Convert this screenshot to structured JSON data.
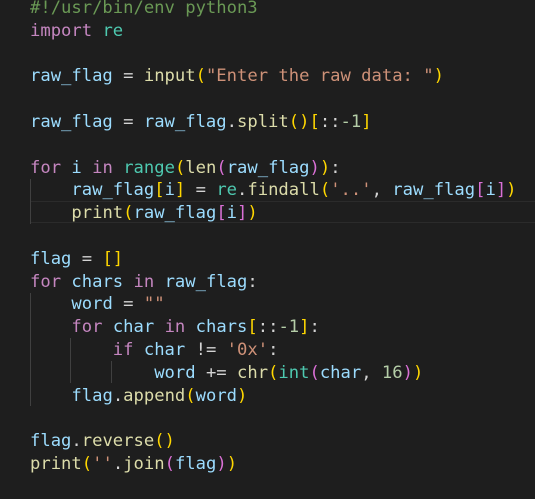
{
  "editor": {
    "language": "python",
    "colors": {
      "background": "#1e1e1e",
      "comment": "#6a9955",
      "keyword": "#c586c0",
      "variable": "#9cdcfe",
      "function": "#dcdcaa",
      "string": "#ce9178",
      "number": "#b5cea8",
      "operator": "#d4d4d4",
      "module": "#4ec9b0",
      "bracket_level_1": "#ffd700",
      "bracket_level_2": "#da70d6",
      "bracket_level_3": "#179fff"
    },
    "lines": [
      {
        "indent": "",
        "tokens": [
          {
            "t": "#!/usr/bin/env python3",
            "c": "comment"
          }
        ]
      },
      {
        "indent": "",
        "tokens": [
          {
            "t": "import",
            "c": "keyword"
          },
          {
            "t": " ",
            "c": "op"
          },
          {
            "t": "re",
            "c": "module"
          }
        ]
      },
      {
        "indent": "",
        "tokens": []
      },
      {
        "indent": "",
        "tokens": [
          {
            "t": "raw_flag",
            "c": "var"
          },
          {
            "t": " = ",
            "c": "op"
          },
          {
            "t": "input",
            "c": "func"
          },
          {
            "t": "(",
            "c": "b1"
          },
          {
            "t": "\"Enter the raw data: \"",
            "c": "str"
          },
          {
            "t": ")",
            "c": "b1"
          }
        ]
      },
      {
        "indent": "",
        "tokens": []
      },
      {
        "indent": "",
        "tokens": [
          {
            "t": "raw_flag",
            "c": "var"
          },
          {
            "t": " = ",
            "c": "op"
          },
          {
            "t": "raw_flag",
            "c": "var"
          },
          {
            "t": ".",
            "c": "op"
          },
          {
            "t": "split",
            "c": "func"
          },
          {
            "t": "()",
            "c": "b1"
          },
          {
            "t": "[",
            "c": "b1"
          },
          {
            "t": "::",
            "c": "op"
          },
          {
            "t": "-1",
            "c": "num"
          },
          {
            "t": "]",
            "c": "b1"
          }
        ]
      },
      {
        "indent": "",
        "tokens": []
      },
      {
        "indent": "",
        "tokens": [
          {
            "t": "for",
            "c": "keyword"
          },
          {
            "t": " ",
            "c": "op"
          },
          {
            "t": "i",
            "c": "var"
          },
          {
            "t": " ",
            "c": "op"
          },
          {
            "t": "in",
            "c": "keyword"
          },
          {
            "t": " ",
            "c": "op"
          },
          {
            "t": "range",
            "c": "module"
          },
          {
            "t": "(",
            "c": "b1"
          },
          {
            "t": "len",
            "c": "func"
          },
          {
            "t": "(",
            "c": "b2"
          },
          {
            "t": "raw_flag",
            "c": "var"
          },
          {
            "t": ")",
            "c": "b2"
          },
          {
            "t": ")",
            "c": "b1"
          },
          {
            "t": ":",
            "c": "op"
          }
        ]
      },
      {
        "indent": "    ",
        "tokens": [
          {
            "t": "raw_flag",
            "c": "var"
          },
          {
            "t": "[",
            "c": "b1"
          },
          {
            "t": "i",
            "c": "var"
          },
          {
            "t": "]",
            "c": "b1"
          },
          {
            "t": " = ",
            "c": "op"
          },
          {
            "t": "re",
            "c": "module"
          },
          {
            "t": ".",
            "c": "op"
          },
          {
            "t": "findall",
            "c": "func"
          },
          {
            "t": "(",
            "c": "b1"
          },
          {
            "t": "'..'",
            "c": "str"
          },
          {
            "t": ", ",
            "c": "op"
          },
          {
            "t": "raw_flag",
            "c": "var"
          },
          {
            "t": "[",
            "c": "b2"
          },
          {
            "t": "i",
            "c": "var"
          },
          {
            "t": "]",
            "c": "b2"
          },
          {
            "t": ")",
            "c": "b1"
          }
        ]
      },
      {
        "indent": "    ",
        "tokens": [
          {
            "t": "print",
            "c": "func"
          },
          {
            "t": "(",
            "c": "b1"
          },
          {
            "t": "raw_flag",
            "c": "var"
          },
          {
            "t": "[",
            "c": "b2"
          },
          {
            "t": "i",
            "c": "var"
          },
          {
            "t": "]",
            "c": "b2"
          },
          {
            "t": ")",
            "c": "b1"
          }
        ]
      },
      {
        "indent": "",
        "tokens": []
      },
      {
        "indent": "",
        "tokens": [
          {
            "t": "flag",
            "c": "var"
          },
          {
            "t": " = ",
            "c": "op"
          },
          {
            "t": "[]",
            "c": "b1"
          }
        ]
      },
      {
        "indent": "",
        "tokens": [
          {
            "t": "for",
            "c": "keyword"
          },
          {
            "t": " ",
            "c": "op"
          },
          {
            "t": "chars",
            "c": "var"
          },
          {
            "t": " ",
            "c": "op"
          },
          {
            "t": "in",
            "c": "keyword"
          },
          {
            "t": " ",
            "c": "op"
          },
          {
            "t": "raw_flag",
            "c": "var"
          },
          {
            "t": ":",
            "c": "op"
          }
        ]
      },
      {
        "indent": "    ",
        "tokens": [
          {
            "t": "word",
            "c": "var"
          },
          {
            "t": " = ",
            "c": "op"
          },
          {
            "t": "\"\"",
            "c": "str"
          }
        ]
      },
      {
        "indent": "    ",
        "tokens": [
          {
            "t": "for",
            "c": "keyword"
          },
          {
            "t": " ",
            "c": "op"
          },
          {
            "t": "char",
            "c": "var"
          },
          {
            "t": " ",
            "c": "op"
          },
          {
            "t": "in",
            "c": "keyword"
          },
          {
            "t": " ",
            "c": "op"
          },
          {
            "t": "chars",
            "c": "var"
          },
          {
            "t": "[",
            "c": "b1"
          },
          {
            "t": "::",
            "c": "op"
          },
          {
            "t": "-1",
            "c": "num"
          },
          {
            "t": "]",
            "c": "b1"
          },
          {
            "t": ":",
            "c": "op"
          }
        ]
      },
      {
        "indent": "        ",
        "tokens": [
          {
            "t": "if",
            "c": "keyword"
          },
          {
            "t": " ",
            "c": "op"
          },
          {
            "t": "char",
            "c": "var"
          },
          {
            "t": " != ",
            "c": "op"
          },
          {
            "t": "'0x'",
            "c": "str"
          },
          {
            "t": ":",
            "c": "op"
          }
        ]
      },
      {
        "indent": "            ",
        "tokens": [
          {
            "t": "word",
            "c": "var"
          },
          {
            "t": " += ",
            "c": "op"
          },
          {
            "t": "chr",
            "c": "func"
          },
          {
            "t": "(",
            "c": "b1"
          },
          {
            "t": "int",
            "c": "module"
          },
          {
            "t": "(",
            "c": "b2"
          },
          {
            "t": "char",
            "c": "var"
          },
          {
            "t": ", ",
            "c": "op"
          },
          {
            "t": "16",
            "c": "num"
          },
          {
            "t": ")",
            "c": "b2"
          },
          {
            "t": ")",
            "c": "b1"
          }
        ]
      },
      {
        "indent": "    ",
        "tokens": [
          {
            "t": "flag",
            "c": "var"
          },
          {
            "t": ".",
            "c": "op"
          },
          {
            "t": "append",
            "c": "func"
          },
          {
            "t": "(",
            "c": "b1"
          },
          {
            "t": "word",
            "c": "var"
          },
          {
            "t": ")",
            "c": "b1"
          }
        ]
      },
      {
        "indent": "",
        "tokens": []
      },
      {
        "indent": "",
        "tokens": [
          {
            "t": "flag",
            "c": "var"
          },
          {
            "t": ".",
            "c": "op"
          },
          {
            "t": "reverse",
            "c": "func"
          },
          {
            "t": "()",
            "c": "b1"
          }
        ]
      },
      {
        "indent": "",
        "tokens": [
          {
            "t": "print",
            "c": "func"
          },
          {
            "t": "(",
            "c": "b1"
          },
          {
            "t": "''",
            "c": "str"
          },
          {
            "t": ".",
            "c": "op"
          },
          {
            "t": "join",
            "c": "func"
          },
          {
            "t": "(",
            "c": "b2"
          },
          {
            "t": "flag",
            "c": "var"
          },
          {
            "t": ")",
            "c": "b2"
          },
          {
            "t": ")",
            "c": "b1"
          }
        ]
      }
    ]
  }
}
